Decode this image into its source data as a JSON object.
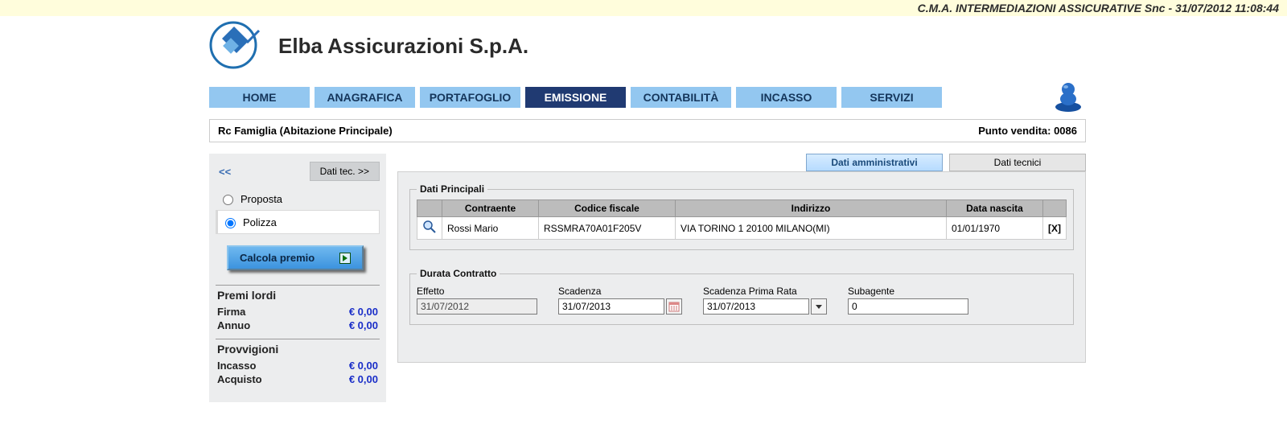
{
  "top_bar": "C.M.A. INTERMEDIAZIONI ASSICURATIVE Snc - 31/07/2012 11:08:44",
  "company_name": "Elba Assicurazioni S.p.A.",
  "nav": {
    "items": [
      "HOME",
      "ANAGRAFICA",
      "PORTAFOGLIO",
      "EMISSIONE",
      "CONTABILITÀ",
      "INCASSO",
      "SERVIZI"
    ],
    "active_index": 3
  },
  "subheader": {
    "left": "Rc Famiglia (Abitazione Principale)",
    "right": "Punto vendita: 0086"
  },
  "sidebar": {
    "back_label": "<<",
    "fwd_label": "Dati tec. >>",
    "radios": {
      "proposta": "Proposta",
      "polizza": "Polizza",
      "selected": "polizza"
    },
    "calc_label": "Calcola premio",
    "premi_title": "Premi lordi",
    "firma_label": "Firma",
    "firma_value": "€ 0,00",
    "annuo_label": "Annuo",
    "annuo_value": "€ 0,00",
    "provv_title": "Provvigioni",
    "incasso_label": "Incasso",
    "incasso_value": "€ 0,00",
    "acquisto_label": "Acquisto",
    "acquisto_value": "€ 0,00"
  },
  "tabs": {
    "admin": "Dati amministrativi",
    "tech": "Dati tecnici",
    "active": "admin"
  },
  "dati_principali": {
    "legend": "Dati Principali",
    "headers": [
      "Contraente",
      "Codice fiscale",
      "Indirizzo",
      "Data nascita"
    ],
    "row": {
      "contraente": "Rossi Mario",
      "cf": "RSSMRA70A01F205V",
      "indirizzo": "VIA TORINO 1 20100 MILANO(MI)",
      "nascita": "01/01/1970",
      "x": "[X]"
    }
  },
  "durata": {
    "legend": "Durata Contratto",
    "effetto_label": "Effetto",
    "effetto": "31/07/2012",
    "scadenza_label": "Scadenza",
    "scadenza": "31/07/2013",
    "prima_rata_label": "Scadenza Prima Rata",
    "prima_rata": "31/07/2013",
    "subagente_label": "Subagente",
    "subagente": "0"
  }
}
